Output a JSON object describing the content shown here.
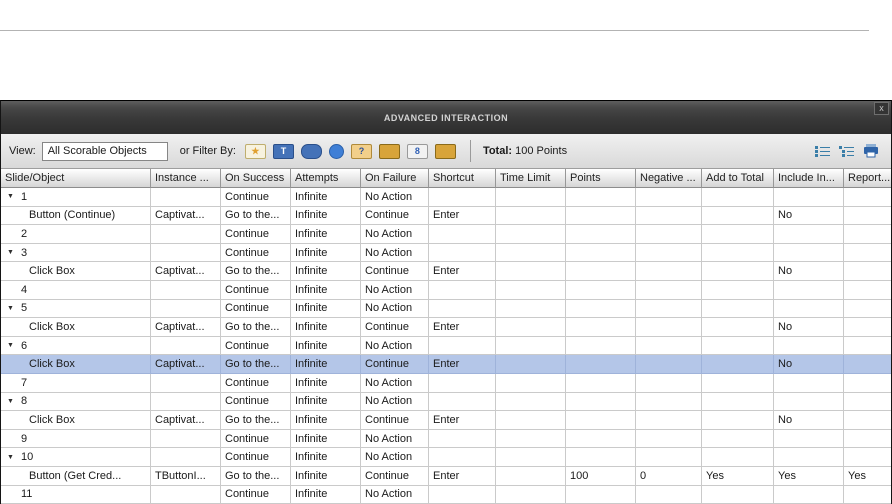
{
  "window": {
    "title": "ADVANCED INTERACTION",
    "close_label": "x"
  },
  "toolbar": {
    "view_label": "View:",
    "view_value": "All Scorable Objects",
    "filter_label": "or Filter By:",
    "filter_icons": [
      {
        "name": "click-box-filter-icon",
        "glyph": "★",
        "fg": "#e0a030",
        "bg": "#f7f2df",
        "border": "#bfae6e",
        "shape": "rect"
      },
      {
        "name": "text-entry-box-filter-icon",
        "glyph": "T",
        "fg": "#ffffff",
        "bg": "#4472b8",
        "border": "#2a4f8a",
        "shape": "rect"
      },
      {
        "name": "button-filter-icon",
        "glyph": "",
        "fg": "#ffffff",
        "bg": "#4472b8",
        "border": "#2a4f8a",
        "shape": "pill"
      },
      {
        "name": "widget-filter-icon",
        "glyph": "",
        "fg": "#ffffff",
        "bg": "#3f7fd6",
        "border": "#2a5fa8",
        "shape": "circle"
      },
      {
        "name": "question-filter-icon",
        "glyph": "?",
        "fg": "#2a4f9a",
        "bg": "#f2cf8a",
        "border": "#b08a3a",
        "shape": "rect"
      },
      {
        "name": "scored-object-filter-icon",
        "glyph": "",
        "fg": "#ffffff",
        "bg": "#d8a43a",
        "border": "#8a6a1a",
        "shape": "rect"
      },
      {
        "name": "link-filter-icon",
        "glyph": "8",
        "fg": "#2f5fb5",
        "bg": "#f2f2f2",
        "border": "#9a9a9a",
        "shape": "rect"
      },
      {
        "name": "other-scorable-filter-icon",
        "glyph": "",
        "fg": "#ffffff",
        "bg": "#d8a43a",
        "border": "#8a6a1a",
        "shape": "rect"
      }
    ],
    "total_label": "Total:",
    "total_value": "100 Points",
    "right_icons": [
      "collapse-all-icon",
      "expand-all-icon",
      "print-icon"
    ]
  },
  "table": {
    "columns": [
      "Slide/Object",
      "Instance ...",
      "On Success",
      "Attempts",
      "On Failure",
      "Shortcut",
      "Time Limit",
      "Points",
      "Negative ...",
      "Add to Total",
      "Include In...",
      "Report..."
    ],
    "rows": [
      {
        "type": "slide",
        "triangle": true,
        "label": "1",
        "selected": false,
        "cells": [
          "",
          "Continue",
          "Infinite",
          "No Action",
          "",
          "",
          "",
          "",
          "",
          "",
          ""
        ]
      },
      {
        "type": "object",
        "triangle": false,
        "label": "Button (Continue)",
        "selected": false,
        "cells": [
          "Captivat...",
          "Go to the...",
          "Infinite",
          "Continue",
          "Enter",
          "",
          "",
          "",
          "",
          "No",
          ""
        ]
      },
      {
        "type": "slide",
        "triangle": false,
        "label": "2",
        "selected": false,
        "cells": [
          "",
          "Continue",
          "Infinite",
          "No Action",
          "",
          "",
          "",
          "",
          "",
          "",
          ""
        ]
      },
      {
        "type": "slide",
        "triangle": true,
        "label": "3",
        "selected": false,
        "cells": [
          "",
          "Continue",
          "Infinite",
          "No Action",
          "",
          "",
          "",
          "",
          "",
          "",
          ""
        ]
      },
      {
        "type": "object",
        "triangle": false,
        "label": "Click Box",
        "selected": false,
        "cells": [
          "Captivat...",
          "Go to the...",
          "Infinite",
          "Continue",
          "Enter",
          "",
          "",
          "",
          "",
          "No",
          ""
        ]
      },
      {
        "type": "slide",
        "triangle": false,
        "label": "4",
        "selected": false,
        "cells": [
          "",
          "Continue",
          "Infinite",
          "No Action",
          "",
          "",
          "",
          "",
          "",
          "",
          ""
        ]
      },
      {
        "type": "slide",
        "triangle": true,
        "label": "5",
        "selected": false,
        "cells": [
          "",
          "Continue",
          "Infinite",
          "No Action",
          "",
          "",
          "",
          "",
          "",
          "",
          ""
        ]
      },
      {
        "type": "object",
        "triangle": false,
        "label": "Click Box",
        "selected": false,
        "cells": [
          "Captivat...",
          "Go to the...",
          "Infinite",
          "Continue",
          "Enter",
          "",
          "",
          "",
          "",
          "No",
          ""
        ]
      },
      {
        "type": "slide",
        "triangle": true,
        "label": "6",
        "selected": false,
        "cells": [
          "",
          "Continue",
          "Infinite",
          "No Action",
          "",
          "",
          "",
          "",
          "",
          "",
          ""
        ]
      },
      {
        "type": "object",
        "triangle": false,
        "label": "Click Box",
        "selected": true,
        "cells": [
          "Captivat...",
          "Go to the...",
          "Infinite",
          "Continue",
          "Enter",
          "",
          "",
          "",
          "",
          "No",
          ""
        ]
      },
      {
        "type": "slide",
        "triangle": false,
        "label": "7",
        "selected": false,
        "cells": [
          "",
          "Continue",
          "Infinite",
          "No Action",
          "",
          "",
          "",
          "",
          "",
          "",
          ""
        ]
      },
      {
        "type": "slide",
        "triangle": true,
        "label": "8",
        "selected": false,
        "cells": [
          "",
          "Continue",
          "Infinite",
          "No Action",
          "",
          "",
          "",
          "",
          "",
          "",
          ""
        ]
      },
      {
        "type": "object",
        "triangle": false,
        "label": "Click Box",
        "selected": false,
        "cells": [
          "Captivat...",
          "Go to the...",
          "Infinite",
          "Continue",
          "Enter",
          "",
          "",
          "",
          "",
          "No",
          ""
        ]
      },
      {
        "type": "slide",
        "triangle": false,
        "label": "9",
        "selected": false,
        "cells": [
          "",
          "Continue",
          "Infinite",
          "No Action",
          "",
          "",
          "",
          "",
          "",
          "",
          ""
        ]
      },
      {
        "type": "slide",
        "triangle": true,
        "label": "10",
        "selected": false,
        "cells": [
          "",
          "Continue",
          "Infinite",
          "No Action",
          "",
          "",
          "",
          "",
          "",
          "",
          ""
        ]
      },
      {
        "type": "object",
        "triangle": false,
        "label": "Button (Get Cred...",
        "selected": false,
        "cells": [
          "TButtonI...",
          "Go to the...",
          "Infinite",
          "Continue",
          "Enter",
          "",
          "100",
          "0",
          "Yes",
          "Yes",
          "Yes"
        ]
      },
      {
        "type": "slide",
        "triangle": false,
        "label": "11",
        "selected": false,
        "cells": [
          "",
          "Continue",
          "Infinite",
          "No Action",
          "",
          "",
          "",
          "",
          "",
          "",
          ""
        ]
      }
    ]
  }
}
